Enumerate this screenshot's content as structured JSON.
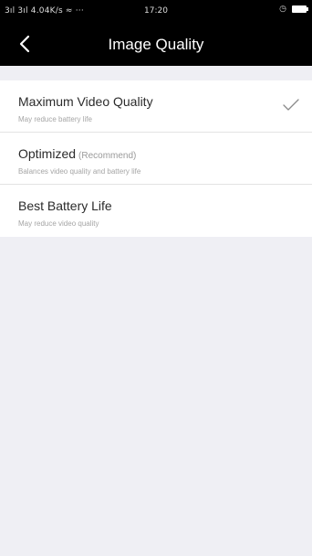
{
  "status_bar": {
    "left_text": "3ıl 3ıl 4.04K/s ≈ ···",
    "time": "17:20",
    "alarm_icon": "alarm-icon",
    "battery_icon": "battery-icon"
  },
  "nav": {
    "back_icon": "chevron-left-icon",
    "title": "Image Quality"
  },
  "options": [
    {
      "title": "Maximum Video Quality",
      "note": "",
      "subtitle": "May reduce battery life",
      "selected": true
    },
    {
      "title": "Optimized",
      "note": "(Recommend)",
      "subtitle": "Balances video quality and battery life",
      "selected": false
    },
    {
      "title": "Best Battery Life",
      "note": "",
      "subtitle": "May reduce video quality",
      "selected": false
    }
  ],
  "colors": {
    "background": "#efeff4",
    "header": "#000000",
    "row": "#ffffff",
    "divider": "#e3e3e3"
  }
}
